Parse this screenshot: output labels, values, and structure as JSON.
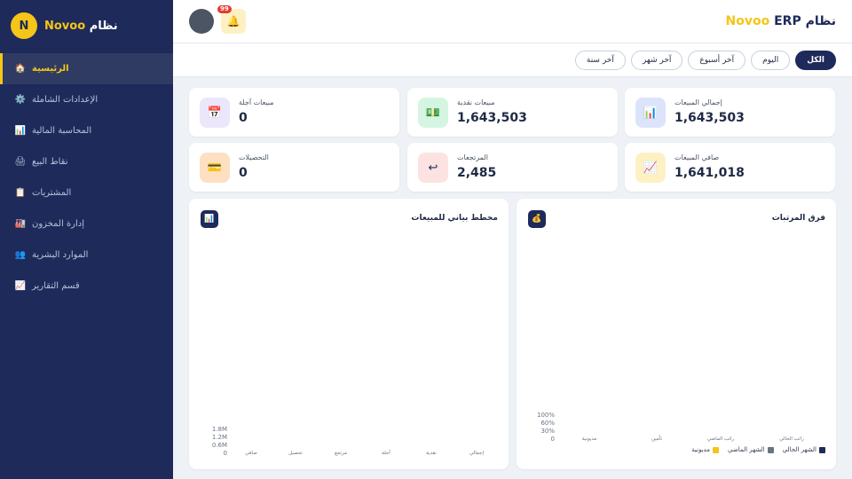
{
  "sidebar": {
    "brand": {
      "logo_letter": "N",
      "name_prefix": "نظام",
      "name_highlight": "Novoo"
    },
    "items": [
      {
        "label": "الرئيسية",
        "icon": "home-icon",
        "glyph": "🏠",
        "active": true
      },
      {
        "label": "الإعدادات الشاملة",
        "icon": "gear-icon",
        "glyph": "⚙️",
        "active": false
      },
      {
        "label": "المحاسبة المالية",
        "icon": "chart-icon",
        "glyph": "📊",
        "active": false
      },
      {
        "label": "نقاط البيع",
        "icon": "pos-icon",
        "glyph": "🖨",
        "active": false
      },
      {
        "label": "المشتريات",
        "icon": "clipboard-icon",
        "glyph": "📋",
        "active": false
      },
      {
        "label": "إدارة المخزون",
        "icon": "factory-icon",
        "glyph": "🏭",
        "active": false
      },
      {
        "label": "الموارد البشرية",
        "icon": "people-icon",
        "glyph": "👥",
        "active": false
      },
      {
        "label": "قسم التقارير",
        "icon": "report-icon",
        "glyph": "📈",
        "active": false
      }
    ]
  },
  "header": {
    "title_prefix": "نظام",
    "title_erp": "ERP",
    "title_brand": "Novoo",
    "notifications": {
      "icon": "bell-icon",
      "glyph": "🔔",
      "count": "99"
    },
    "avatar": "avatar"
  },
  "filters": [
    {
      "label": "الكل",
      "active": true
    },
    {
      "label": "اليوم",
      "active": false
    },
    {
      "label": "آخر أسبوع",
      "active": false
    },
    {
      "label": "آخر شهر",
      "active": false
    },
    {
      "label": "آخر سنة",
      "active": false
    }
  ],
  "stats": {
    "total_sales": {
      "label": "إجمالي المبيعات",
      "value": "1,643,503",
      "icon": "bar-chart-icon",
      "glyph": "📊",
      "color": "#dbe4fb"
    },
    "cash_sales": {
      "label": "مبيعات نقدية",
      "value": "1,643,503",
      "icon": "money-icon",
      "glyph": "💵",
      "color": "#d5f5e3"
    },
    "deferred_sales": {
      "label": "مبيعات آجلة",
      "value": "0",
      "icon": "calendar-icon",
      "glyph": "📅",
      "color": "#ece6fb"
    },
    "net_sales": {
      "label": "صافي المبيعات",
      "value": "1,641,018",
      "icon": "trend-icon",
      "glyph": "📈",
      "color": "#fdf1c4"
    },
    "returns": {
      "label": "المرتجعات",
      "value": "2,485",
      "icon": "return-icon",
      "glyph": "↩",
      "color": "#fde2e2"
    },
    "collections": {
      "label": "التحصيلات",
      "value": "0",
      "icon": "card-icon",
      "glyph": "💳",
      "color": "#fde0c2"
    }
  },
  "panels": {
    "sales_chart": {
      "title": "مخطط بياني للمبيعات",
      "icon": "bar-chart-icon",
      "glyph": "📊"
    },
    "salary_diff": {
      "title": "فرق المرتبات",
      "icon": "money-bag-icon",
      "glyph": "💰"
    }
  },
  "chart_data": [
    {
      "type": "bar",
      "title": "مخطط بياني للمبيعات",
      "categories": [
        "إجمالي",
        "نقدية",
        "آجلة",
        "مرتجع",
        "تحصيل",
        "صافي"
      ],
      "y_ticks": [
        "1.8M",
        "1.2M",
        "0.6M",
        "0"
      ],
      "values": [
        null,
        null,
        null,
        null,
        null,
        null
      ]
    },
    {
      "type": "bar",
      "title": "فرق المرتبات",
      "categories": [
        "راتب الحالي",
        "راتب الماضي",
        "تأمين",
        "مديونية"
      ],
      "y_ticks": [
        "100%",
        "60%",
        "30%",
        "0"
      ],
      "series": [
        {
          "name": "الشهر الحالي",
          "color": "#1e2a5a",
          "values": [
            null,
            null,
            null,
            null
          ]
        },
        {
          "name": "الشهر الماضي",
          "color": "#6b7280",
          "values": [
            null,
            null,
            null,
            null
          ]
        },
        {
          "name": "مديونية",
          "color": "#f5c518",
          "values": [
            null,
            null,
            null,
            null
          ]
        }
      ]
    }
  ]
}
